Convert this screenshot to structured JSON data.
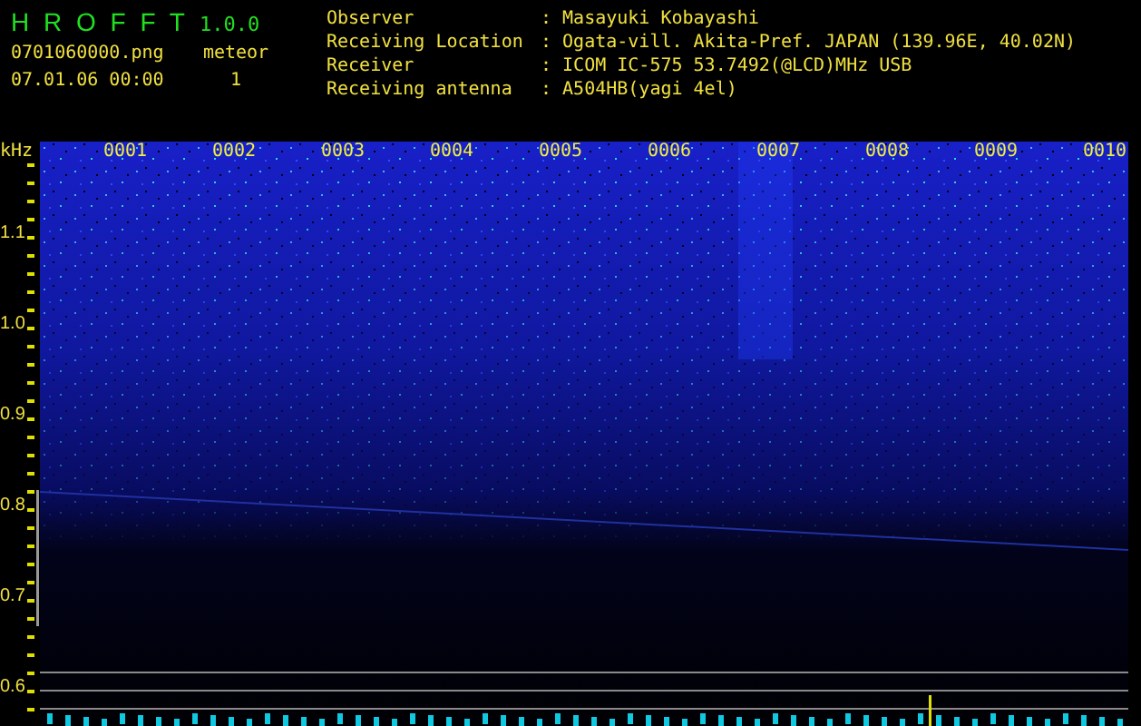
{
  "app": {
    "name": "H R O F F T",
    "version": "1.0.0"
  },
  "file": {
    "name": "0701060000.png",
    "datetime": "07.01.06 00:00"
  },
  "meteor": {
    "label": "meteor",
    "count": "1"
  },
  "info": [
    {
      "label": "Observer",
      "value": ": Masayuki Kobayashi"
    },
    {
      "label": "Receiving Location",
      "value": ": Ogata-vill. Akita-Pref. JAPAN (139.96E, 40.02N)"
    },
    {
      "label": "Receiver",
      "value": ": ICOM IC-575 53.7492(@LCD)MHz USB"
    },
    {
      "label": "Receiving antenna",
      "value": ": A504HB(yagi 4el)"
    }
  ],
  "axis": {
    "unit": "kHz",
    "labels": [
      "1.1",
      "1.0",
      "0.9",
      "0.8",
      "0.7",
      "0.6"
    ]
  },
  "time_labels": [
    "0001",
    "0002",
    "0003",
    "0004",
    "0005",
    "0006",
    "0007",
    "0008",
    "0009",
    "0010"
  ]
}
